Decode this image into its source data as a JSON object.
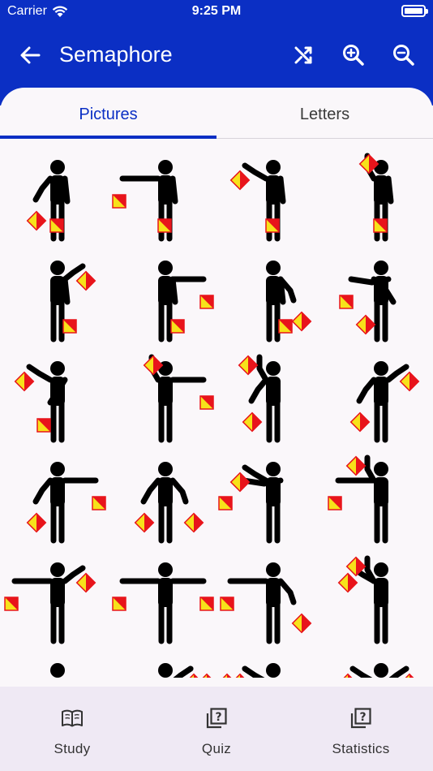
{
  "status_bar": {
    "carrier": "Carrier",
    "time": "9:25 PM"
  },
  "app_bar": {
    "title": "Semaphore",
    "actions": [
      "shuffle-icon",
      "zoom-in-icon",
      "zoom-out-icon"
    ]
  },
  "tabs": [
    {
      "label": "Pictures",
      "active": true
    },
    {
      "label": "Letters",
      "active": false
    }
  ],
  "colors": {
    "primary": "#0b2fc4",
    "flag_red": "#e8141b",
    "flag_yellow": "#f7e21a",
    "figure": "#000000"
  },
  "grid": {
    "columns": 4,
    "items": [
      {
        "name": "semaphore-figure-1",
        "right": "lowleft",
        "left": "down"
      },
      {
        "name": "semaphore-figure-2",
        "right": "left",
        "left": "down"
      },
      {
        "name": "semaphore-figure-3",
        "right": "upleft",
        "left": "down"
      },
      {
        "name": "semaphore-figure-4",
        "right": "up",
        "left": "down"
      },
      {
        "name": "semaphore-figure-5",
        "right": "down",
        "left": "upright"
      },
      {
        "name": "semaphore-figure-6",
        "right": "down",
        "left": "right"
      },
      {
        "name": "semaphore-figure-7",
        "right": "down",
        "left": "lowright"
      },
      {
        "name": "semaphore-figure-8",
        "right": "acrossleft",
        "left": "lowleftx"
      },
      {
        "name": "semaphore-figure-9",
        "right": "upleft",
        "left": "acrossdown"
      },
      {
        "name": "semaphore-figure-10",
        "right": "up",
        "left": "right"
      },
      {
        "name": "semaphore-figure-11",
        "right": "lowleft",
        "left": "up"
      },
      {
        "name": "semaphore-figure-12",
        "right": "lowleft",
        "left": "upright"
      },
      {
        "name": "semaphore-figure-13",
        "right": "lowleft",
        "left": "right"
      },
      {
        "name": "semaphore-figure-14",
        "right": "lowleft",
        "left": "lowright"
      },
      {
        "name": "semaphore-figure-15",
        "right": "upleft",
        "left": "acrossleft"
      },
      {
        "name": "semaphore-figure-16",
        "right": "left",
        "left": "up"
      },
      {
        "name": "semaphore-figure-17",
        "right": "left",
        "left": "upright"
      },
      {
        "name": "semaphore-figure-18",
        "right": "left",
        "left": "right"
      },
      {
        "name": "semaphore-figure-19",
        "right": "left",
        "left": "lowright"
      },
      {
        "name": "semaphore-figure-20",
        "right": "upleft",
        "left": "up"
      },
      {
        "name": "semaphore-figure-21",
        "right": "lowleft",
        "left": "lowleft",
        "partial": true
      },
      {
        "name": "semaphore-figure-22",
        "right": "upright",
        "left": "upright",
        "partial": true
      },
      {
        "name": "semaphore-figure-23",
        "right": "upleft",
        "left": "upleft",
        "partial": true
      },
      {
        "name": "semaphore-figure-24",
        "right": "upleft",
        "left": "upright",
        "partial": true
      }
    ]
  },
  "bottom_nav": [
    {
      "label": "Study",
      "icon": "book-icon"
    },
    {
      "label": "Quiz",
      "icon": "quiz-icon"
    },
    {
      "label": "Statistics",
      "icon": "statistics-icon"
    }
  ]
}
